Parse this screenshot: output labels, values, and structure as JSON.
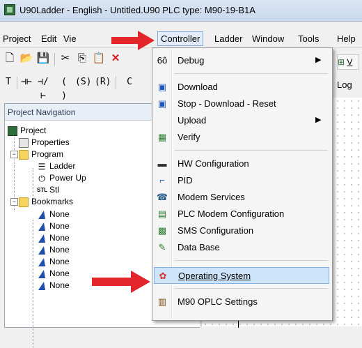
{
  "window": {
    "title": "U90Ladder - English - Untitled.U90   PLC type: M90-19-B1A"
  },
  "menubar": [
    {
      "label": "Project"
    },
    {
      "label": "Edit"
    },
    {
      "label": "Vie"
    },
    {
      "label": "Controller"
    },
    {
      "label": "Ladder"
    },
    {
      "label": "Window"
    },
    {
      "label": "Tools"
    },
    {
      "label": "Help"
    }
  ],
  "toolbar": {
    "row1": [
      "new-icon",
      "open-icon",
      "save-icon",
      "cut-icon",
      "copy-icon",
      "paste-icon",
      "delete-icon"
    ],
    "row2_glyphs": [
      "T",
      "⊣⊢",
      "⊣/⊢",
      "( )",
      "(S)",
      "(R)",
      "C"
    ]
  },
  "right_strip": {
    "sub_label": "V",
    "sub2_label": "Log"
  },
  "navigation": {
    "title": "Project Navigation",
    "tree": [
      {
        "label": "Project",
        "icon": "plc-icon"
      },
      {
        "label": "Properties",
        "icon": "properties-icon"
      },
      {
        "label": "Program",
        "icon": "folder-icon"
      },
      {
        "label": "Ladder",
        "icon": "ladder-icon"
      },
      {
        "label": "Power Up",
        "icon": "powerup-icon"
      },
      {
        "label": "Stl",
        "icon": "stl-icon"
      },
      {
        "label": "Bookmarks",
        "icon": "folder-icon"
      },
      {
        "label": "None",
        "icon": "bookmark-icon"
      },
      {
        "label": "None",
        "icon": "bookmark-icon"
      },
      {
        "label": "None",
        "icon": "bookmark-icon"
      },
      {
        "label": "None",
        "icon": "bookmark-icon"
      },
      {
        "label": "None",
        "icon": "bookmark-icon"
      },
      {
        "label": "None",
        "icon": "bookmark-icon"
      },
      {
        "label": "None",
        "icon": "bookmark-icon"
      }
    ]
  },
  "controller_menu": {
    "items": [
      {
        "label": "Debug",
        "icon": "debug-icon",
        "submenu": true
      },
      {
        "label": "Download",
        "icon": "download-icon"
      },
      {
        "label": "Stop - Download - Reset",
        "icon": "stop-download-icon"
      },
      {
        "label": "Upload",
        "icon": "",
        "submenu": true
      },
      {
        "label": "Verify",
        "icon": "verify-icon"
      },
      {
        "label": "HW Configuration",
        "icon": "hw-config-icon"
      },
      {
        "label": "PID",
        "icon": "pid-icon"
      },
      {
        "label": "Modem Services",
        "icon": "modem-icon"
      },
      {
        "label": "PLC Modem Configuration",
        "icon": "plc-modem-icon"
      },
      {
        "label": "SMS Configuration",
        "icon": "sms-icon"
      },
      {
        "label": "Data Base",
        "icon": "database-icon"
      },
      {
        "label": "Operating System",
        "icon": "os-icon",
        "highlighted": true
      },
      {
        "label": "M90 OPLC Settings",
        "icon": "oplc-settings-icon"
      }
    ],
    "submenu_arrow": "▶"
  },
  "colors": {
    "highlight": "#cde4fb",
    "arrow": "#e3262b",
    "folder": "#f4d35e"
  }
}
